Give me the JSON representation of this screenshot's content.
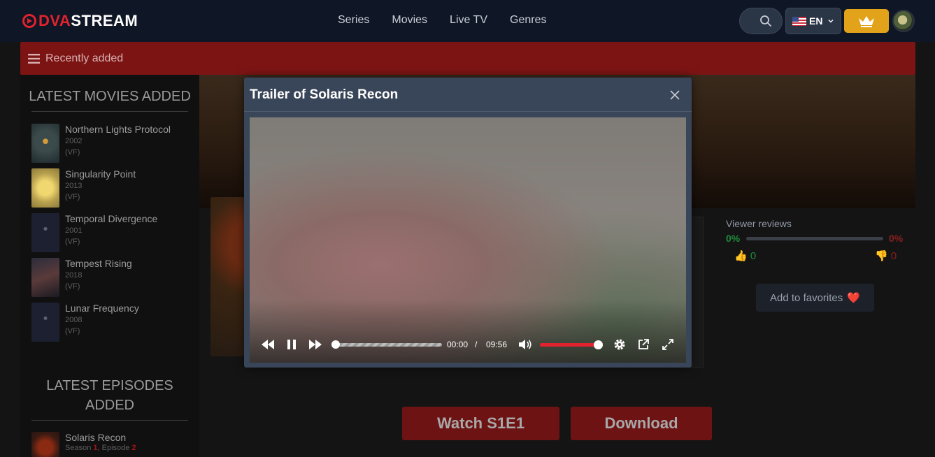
{
  "header": {
    "logo_part1": "DVA",
    "logo_part2": "STREAM",
    "nav": [
      "Series",
      "Movies",
      "Live TV",
      "Genres"
    ],
    "language": "EN"
  },
  "banner": {
    "label": "Recently added"
  },
  "sidebar": {
    "movies_heading": "LATEST MOVIES ADDED",
    "movies": [
      {
        "title": "Northern Lights Protocol",
        "year": "2002",
        "lang": "(VF)"
      },
      {
        "title": "Singularity Point",
        "year": "2013",
        "lang": "(VF)"
      },
      {
        "title": "Temporal Divergence",
        "year": "2001",
        "lang": "(VF)"
      },
      {
        "title": "Tempest Rising",
        "year": "2018",
        "lang": "(VF)"
      },
      {
        "title": "Lunar Frequency",
        "year": "2008",
        "lang": "(VF)"
      }
    ],
    "episodes_heading_1": "LATEST EPISODES",
    "episodes_heading_2": "ADDED",
    "episodes": [
      {
        "title": "Solaris Recon",
        "season_label": "Season",
        "season": "1",
        "episode_label": "Episode",
        "episode": "2"
      }
    ]
  },
  "reviews": {
    "label": "Viewer reviews",
    "positive_pct": "0%",
    "negative_pct": "0%",
    "likes": "0",
    "dislikes": "0"
  },
  "favorites": {
    "label": "Add to favorites",
    "heart": "❤️"
  },
  "actions": {
    "watch": "Watch S1E1",
    "download": "Download"
  },
  "modal": {
    "title": "Trailer of Solaris Recon",
    "player": {
      "current_time": "00:00",
      "separator": "/",
      "duration": "09:56",
      "progress": 0,
      "volume": 1.0
    }
  },
  "colors": {
    "header_bg": "#0f1625",
    "brand_red": "#e0232e",
    "banner_red": "#7c1414",
    "premium_gold": "#e2a21a",
    "modal_bg": "#394558"
  }
}
